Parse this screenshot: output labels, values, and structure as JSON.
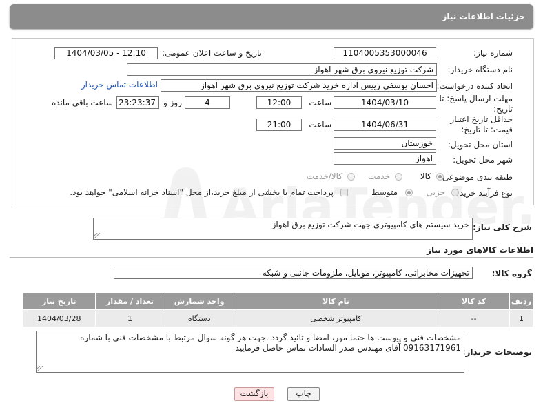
{
  "header": {
    "title": "جزئیات اطلاعات نیاز"
  },
  "form": {
    "need_number_label": "شماره نیاز:",
    "need_number": "1104005353000046",
    "announce_label": "تاریخ و ساعت اعلان عمومی:",
    "announce_value": "1404/03/05 - 12:10",
    "buyer_org_label": "نام دستگاه خریدار:",
    "buyer_org": "شرکت توزیع نیروی برق شهر اهواز",
    "creator_label": "ایجاد کننده درخواست:",
    "creator": "احسان یوسفی رییس اداره خرید شرکت توزیع نیروی برق شهر اهواز",
    "contact_link": "اطلاعات تماس خریدار",
    "deadline_label": "مهلت ارسال پاسخ: تا تاریخ:",
    "deadline_date": "1404/03/10",
    "time_label": "ساعت",
    "deadline_time": "12:00",
    "days_value": "4",
    "days_label": "روز و",
    "remaining_time": "23:23:37",
    "remaining_label": "ساعت باقی مانده",
    "validity_label": "حداقل تاریخ اعتبار قیمت: تا تاریخ:",
    "validity_date": "1404/06/31",
    "validity_time": "21:00",
    "province_label": "استان محل تحویل:",
    "province": "خوزستان",
    "city_label": "شهر محل تحویل:",
    "city": "اهواز",
    "category_label": "طبقه بندی موضوعی:",
    "category_options": [
      "کالا",
      "خدمت",
      "کالا/خدمت"
    ],
    "process_label": "نوع فرآیند خرید :",
    "process_options": [
      "جزیی",
      "متوسط"
    ],
    "payment_note": "پرداخت تمام یا بخشی از مبلغ خرید،از محل \"اسناد خزانه اسلامی\" خواهد بود."
  },
  "summary": {
    "label": "شرح کلی نیاز:",
    "value": "خرید سیستم های کامپیوتری جهت شرکت توزیع برق اهواز"
  },
  "goods": {
    "section_title": "اطلاعات کالاهای مورد نیاز",
    "group_label": "گروه کالا:",
    "group_value": "تجهیزات مخابراتی، کامپیوتر، موبایل، ملزومات جانبی و شبکه",
    "columns": [
      "ردیف",
      "کد کالا",
      "نام کالا",
      "واحد شمارش",
      "تعداد / مقدار",
      "تاریخ نیاز"
    ],
    "rows": [
      {
        "row": "1",
        "code": "--",
        "name": "کامپیوتر شخصی",
        "unit": "دستگاه",
        "qty": "1",
        "date": "1404/03/28"
      }
    ]
  },
  "notes": {
    "label": "توضیحات خریدار:",
    "value": "مشخصات فنی و پیوست ها حتما مهر، امضا و تائید گردد .جهت هر گونه سوال مرتبط با مشخصات فنی با شماره 09163171961 آقای مهندس صدر السادات تماس حاصل فرمایید"
  },
  "buttons": {
    "print": "چاپ",
    "back": "بازگشت"
  },
  "watermark": {
    "text": "AriaTender.neT"
  },
  "colors": {
    "header_bg": "#8c8c8c",
    "table_header": "#9b9b9b",
    "link": "#1f53b8",
    "back_button_bg": "#fde3e3"
  }
}
